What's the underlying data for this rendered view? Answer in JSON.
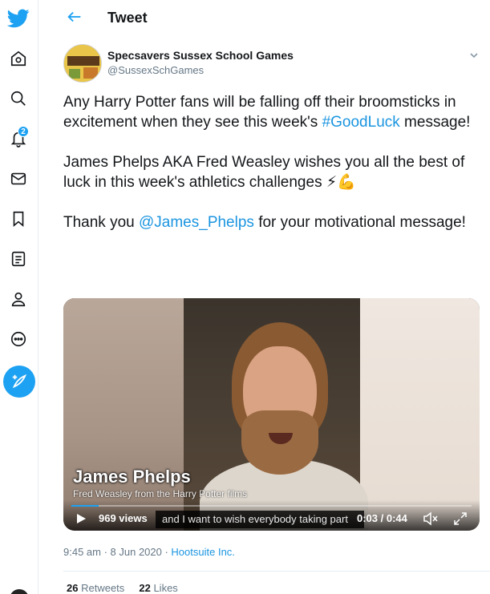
{
  "sidebar": {
    "notification_count": "2",
    "items": [
      {
        "icon": "twitter-bird-icon"
      },
      {
        "icon": "home-icon"
      },
      {
        "icon": "search-icon"
      },
      {
        "icon": "notifications-icon"
      },
      {
        "icon": "messages-icon"
      },
      {
        "icon": "bookmarks-icon"
      },
      {
        "icon": "lists-icon"
      },
      {
        "icon": "profile-icon"
      },
      {
        "icon": "more-icon"
      },
      {
        "icon": "compose-tweet-icon"
      }
    ]
  },
  "header": {
    "title": "Tweet"
  },
  "tweet": {
    "author_name": "Specsavers Sussex School Games",
    "author_handle": "@SussexSchGames",
    "para1_pre": "Any Harry Potter fans will be falling off their broomsticks in excitement when they see this week's ",
    "para1_hashtag": "#GoodLuck",
    "para1_post": " message!",
    "para2": "James Phelps AKA Fred Weasley wishes you all the best of luck in this week's athletics challenges ⚡💪",
    "para3_pre": "Thank you ",
    "para3_mention": "@James_Phelps",
    "para3_post": " for your motivational message!",
    "timestamp": "9:45 am · 8 Jun 2020",
    "separator": " · ",
    "source": "Hootsuite Inc.",
    "retweets_count": "26",
    "retweets_label": "Retweets",
    "likes_count": "22",
    "likes_label": "Likes"
  },
  "video": {
    "overlay_name": "James Phelps",
    "overlay_subtitle": "Fred Weasley from the Harry Potter films",
    "views": "969 views",
    "caption": "and I want to wish everybody taking part",
    "time": "0:03 / 0:44",
    "progress": 0.068
  },
  "colors": {
    "accent": "#1da1f2",
    "link": "#1b95e0",
    "muted": "#657786"
  }
}
